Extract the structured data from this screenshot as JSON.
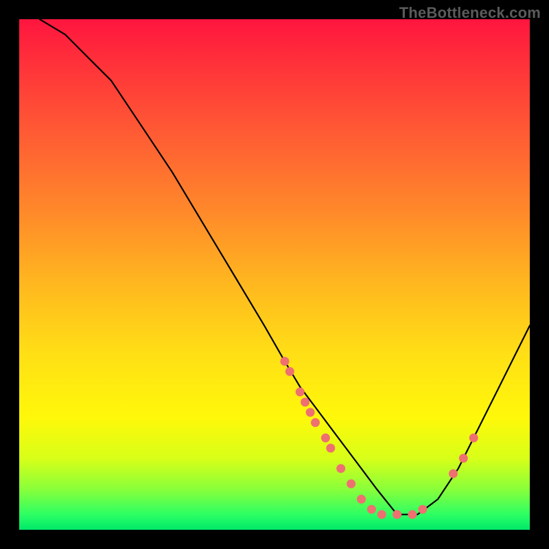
{
  "watermark": "TheBottleneck.com",
  "colors": {
    "gradient_top": "#ff153f",
    "gradient_bottom": "#00e86a",
    "curve": "#000000",
    "dot": "#ef7070",
    "frame_bg": "#000000"
  },
  "chart_data": {
    "type": "line",
    "title": "",
    "xlabel": "",
    "ylabel": "",
    "xlim": [
      0,
      100
    ],
    "ylim": [
      0,
      100
    ],
    "grid": false,
    "legend": false,
    "comment": "Values estimated from pixel positions; y increases upward, curve minimum near x≈74.",
    "series": [
      {
        "name": "curve",
        "x": [
          4,
          9,
          13,
          18,
          24,
          30,
          36,
          42,
          48,
          52,
          55,
          58,
          61,
          64,
          67,
          70,
          74,
          78,
          82,
          86,
          90,
          94,
          98,
          100
        ],
        "y": [
          100,
          97,
          93,
          88,
          79,
          70,
          60,
          50,
          40,
          33,
          28,
          24,
          20,
          16,
          12,
          8,
          3,
          3,
          6,
          12,
          20,
          28,
          36,
          40
        ]
      }
    ],
    "points": [
      {
        "x": 52,
        "y": 33
      },
      {
        "x": 53,
        "y": 31
      },
      {
        "x": 55,
        "y": 27
      },
      {
        "x": 56,
        "y": 25
      },
      {
        "x": 57,
        "y": 23
      },
      {
        "x": 58,
        "y": 21
      },
      {
        "x": 60,
        "y": 18
      },
      {
        "x": 61,
        "y": 16
      },
      {
        "x": 63,
        "y": 12
      },
      {
        "x": 65,
        "y": 9
      },
      {
        "x": 67,
        "y": 6
      },
      {
        "x": 69,
        "y": 4
      },
      {
        "x": 71,
        "y": 3
      },
      {
        "x": 74,
        "y": 3
      },
      {
        "x": 77,
        "y": 3
      },
      {
        "x": 79,
        "y": 4
      },
      {
        "x": 85,
        "y": 11
      },
      {
        "x": 87,
        "y": 14
      },
      {
        "x": 89,
        "y": 18
      }
    ]
  }
}
